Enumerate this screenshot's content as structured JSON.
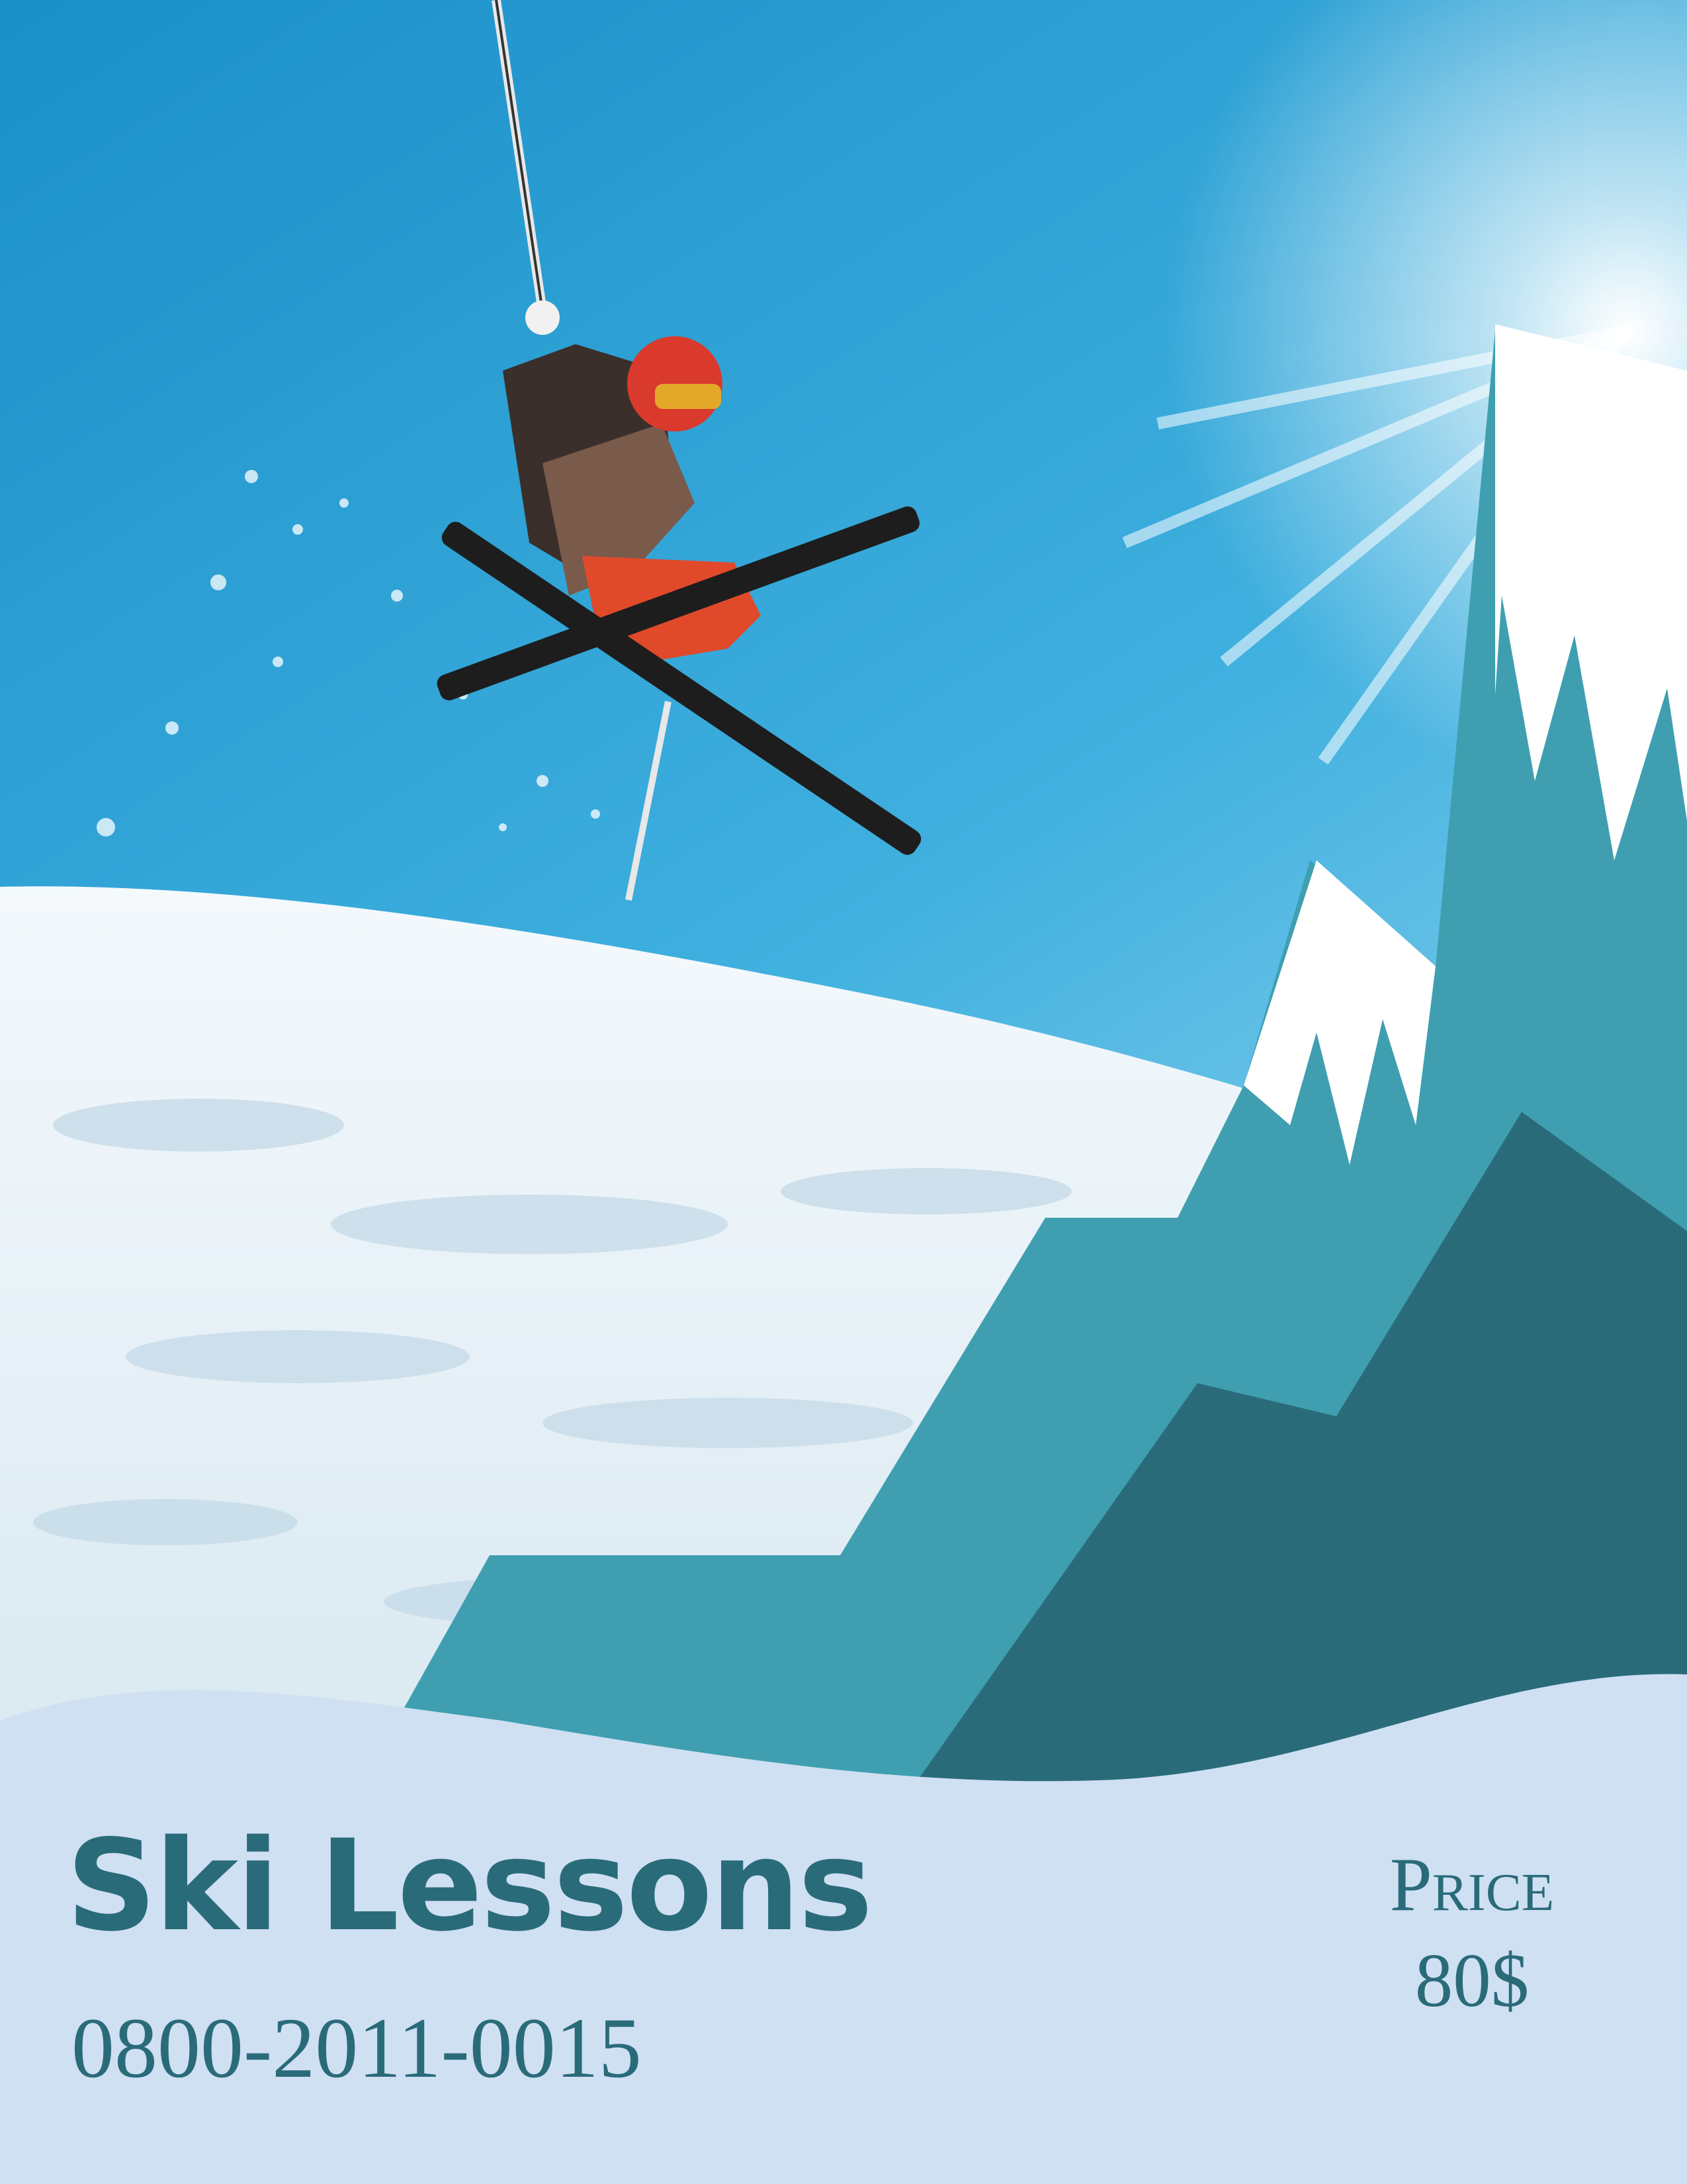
{
  "flyer": {
    "title": "Ski Lessons",
    "phone": "0800-2011-0015",
    "price_label": "Price",
    "price_value": "80$"
  },
  "colors": {
    "sky_top": "#1f9ad0",
    "sky_bottom": "#6cc0e4",
    "snow": "#eef5fa",
    "mountain_light": "#3f9fb0",
    "mountain_dark": "#2a6b7a",
    "footer": "#cfe0f2",
    "text": "#2a6b7a"
  },
  "illustration": {
    "photo_subject": "skier-jumping-icon",
    "mountains": "mountain-peaks-icon"
  }
}
